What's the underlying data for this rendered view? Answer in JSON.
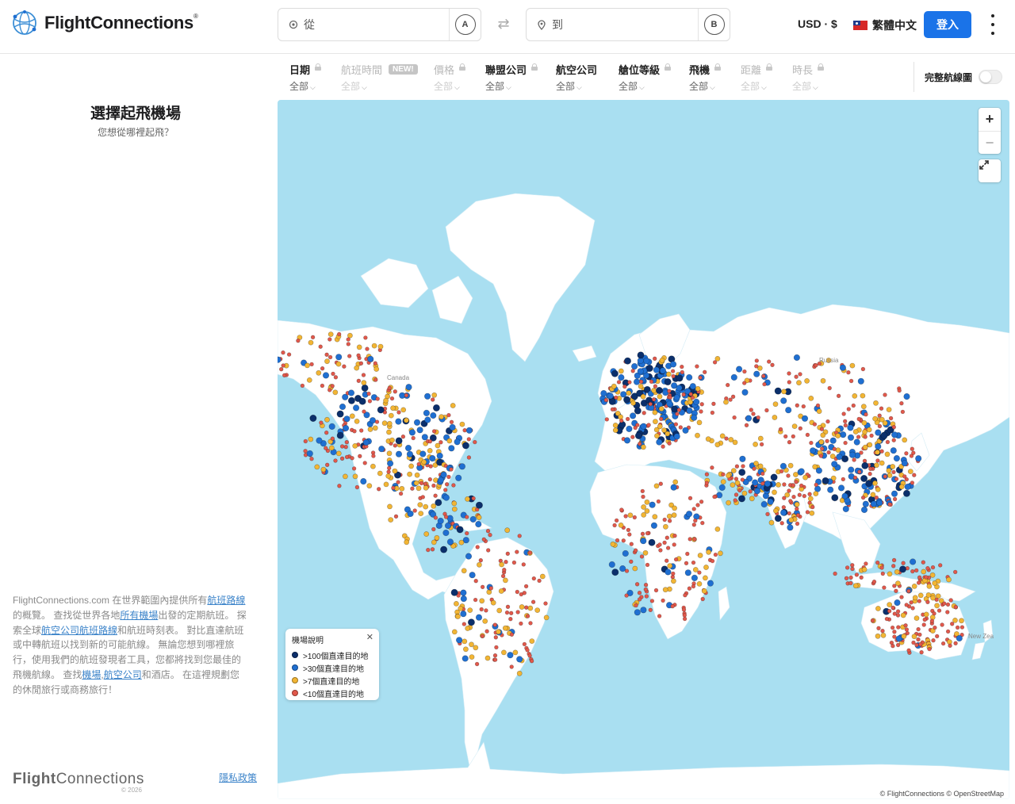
{
  "header": {
    "logo_text": "FlightConnections",
    "from_placeholder": "從",
    "from_badge": "A",
    "to_placeholder": "到",
    "to_badge": "B",
    "swap_icon": "⇄",
    "currency": "USD · $",
    "language": "繁體中文",
    "login_label": "登入"
  },
  "filters": [
    {
      "label": "日期",
      "value": "全部",
      "locked": true,
      "disabled": false
    },
    {
      "label": "航班時間",
      "value": "全部",
      "badge": "NEW!",
      "disabled": true
    },
    {
      "label": "價格",
      "value": "全部",
      "locked": true,
      "disabled": true
    },
    {
      "label": "聯盟公司",
      "value": "全部",
      "locked": true,
      "disabled": false
    },
    {
      "label": "航空公司",
      "value": "全部",
      "disabled": false
    },
    {
      "label": "艙位等級",
      "value": "全部",
      "locked": true,
      "disabled": false
    },
    {
      "label": "飛機",
      "value": "全部",
      "locked": true,
      "disabled": false
    },
    {
      "label": "距離",
      "value": "全部",
      "locked": true,
      "disabled": true
    },
    {
      "label": "時長",
      "value": "全部",
      "locked": true,
      "disabled": true
    }
  ],
  "full_map_label": "完整航線圖",
  "sidebar": {
    "title": "選擇起飛機場",
    "subtitle": "您想從哪裡起飛？",
    "desc": {
      "t1": "FlightConnections.com 在世界範圍內提供所有",
      "l1": "航班路線",
      "t2": "的概覽。 查找從世界各地",
      "l2": "所有機場",
      "t3": "出發的定期航班。 探索全球",
      "l3": "航空公司航班路線",
      "t4": "和航班時刻表。 對比直達航班或中轉航班以找到新的可能航線。 無論您想到哪裡旅行，使用我們的航班發現者工具，您都將找到您最佳的飛機航線。 查找",
      "l4": "機場",
      "t5": ",",
      "l5": "航空公司",
      "t6": "和酒店。 在這裡規劃您的休閒旅行或商務旅行！"
    },
    "footer_logo_bold": "Flight",
    "footer_logo_rest": "Connections",
    "copyright": "© 2026",
    "privacy": "隱私政策"
  },
  "map": {
    "zoom_in": "+",
    "zoom_out": "−",
    "attribution": "© FlightConnections © OpenStreetMap",
    "labels": {
      "canada": "Canada",
      "russia": "Russia",
      "new_zealand": "New Zea"
    },
    "ocean_color": "#a9dff1",
    "land_color": "#ffffff",
    "legend": {
      "title": "機場說明",
      "close": "✕",
      "items": [
        {
          "label": ">100個直達目的地",
          "color": "#0b2f6b"
        },
        {
          "label": ">30個直達目的地",
          "color": "#1f6fd1"
        },
        {
          "label": ">7個直達目的地",
          "color": "#f2b534"
        },
        {
          "label": "<10個直達目的地",
          "color": "#e1584b"
        }
      ]
    }
  }
}
